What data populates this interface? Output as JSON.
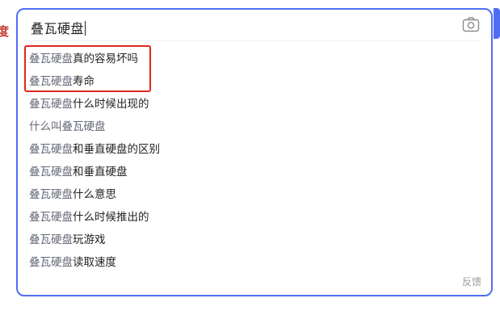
{
  "left_fragment": "度",
  "search": {
    "query": "叠瓦硬盘",
    "camera_icon": "camera-icon"
  },
  "suggestions": [
    {
      "prefix": "叠瓦硬盘",
      "suffix": "真的容易坏吗"
    },
    {
      "prefix": "叠瓦硬盘",
      "suffix": "寿命"
    },
    {
      "prefix": "叠瓦硬盘",
      "suffix": "什么时候出现的"
    },
    {
      "prefix": "什么叫叠瓦硬盘",
      "suffix": ""
    },
    {
      "prefix": "叠瓦硬盘",
      "suffix": "和垂直硬盘的区别"
    },
    {
      "prefix": "叠瓦硬盘",
      "suffix": "和垂直硬盘"
    },
    {
      "prefix": "叠瓦硬盘",
      "suffix": "什么意思"
    },
    {
      "prefix": "叠瓦硬盘",
      "suffix": "什么时候推出的"
    },
    {
      "prefix": "叠瓦硬盘",
      "suffix": "玩游戏"
    },
    {
      "prefix": "叠瓦硬盘",
      "suffix": "读取速度"
    }
  ],
  "feedback_label": "反馈",
  "colors": {
    "accent": "#4e6ef2",
    "highlight_border": "#e0281d"
  }
}
